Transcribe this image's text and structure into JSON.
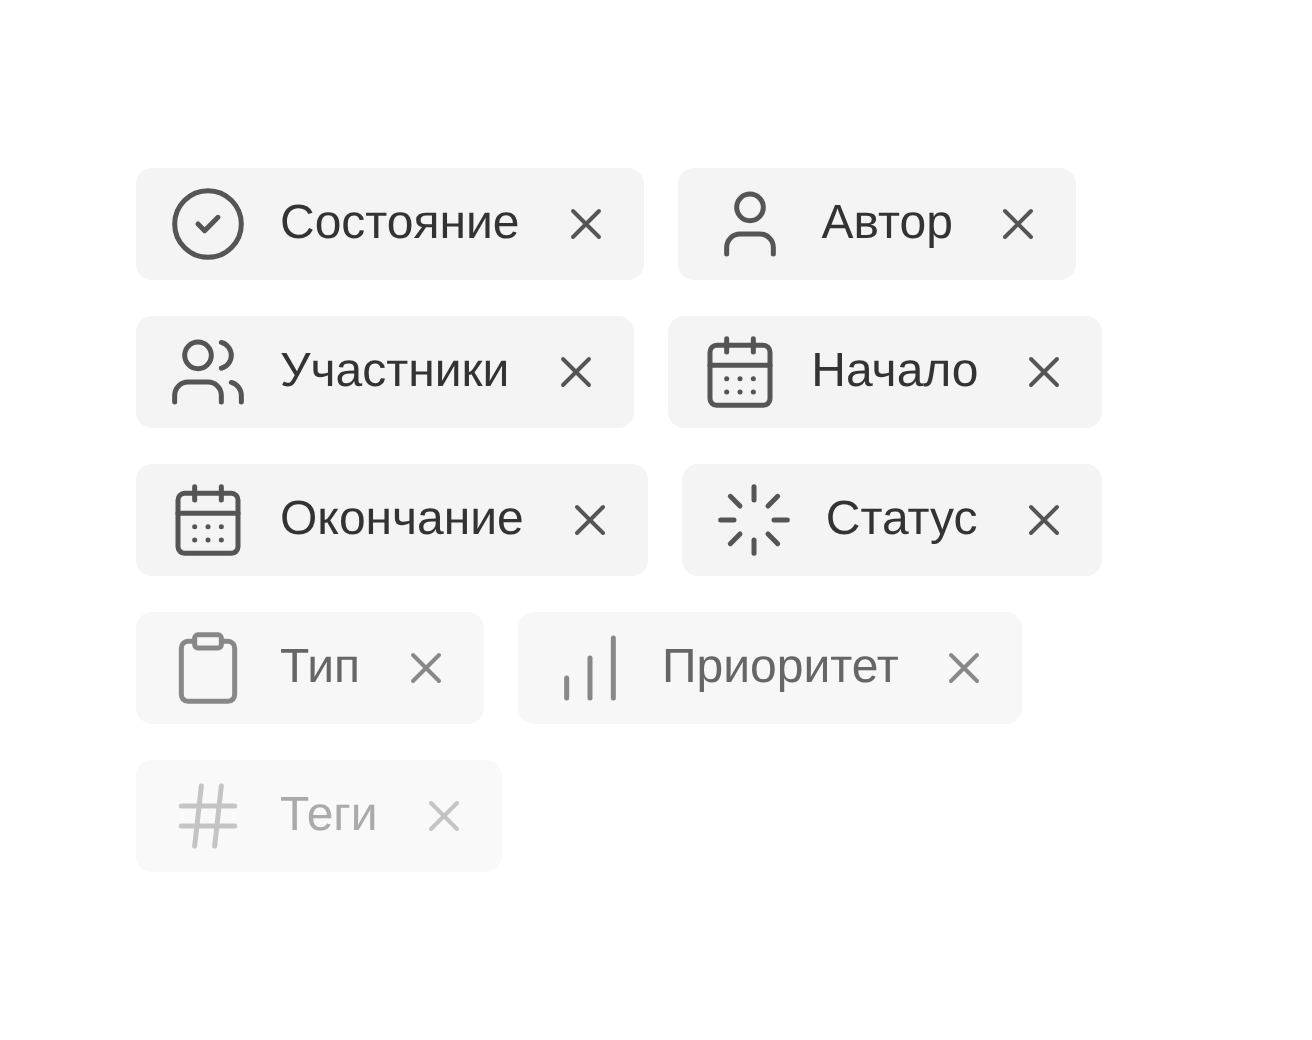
{
  "filter_chips": [
    [
      {
        "kind": "check",
        "label": "Состояние"
      },
      {
        "kind": "person",
        "label": "Автор"
      }
    ],
    [
      {
        "kind": "people",
        "label": "Участники"
      },
      {
        "kind": "calendar",
        "label": "Начало"
      }
    ],
    [
      {
        "kind": "calendar",
        "label": "Окончание"
      },
      {
        "kind": "spinner",
        "label": "Статус"
      }
    ],
    [
      {
        "kind": "clipboard",
        "label": "Тип"
      },
      {
        "kind": "bars",
        "label": "Приоритет"
      }
    ],
    [
      {
        "kind": "hash",
        "label": "Теги"
      }
    ]
  ]
}
